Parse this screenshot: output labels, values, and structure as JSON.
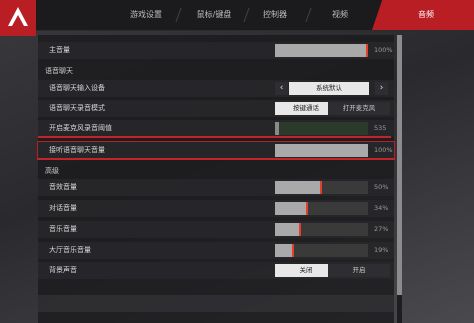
{
  "tabs": [
    {
      "label": "游戏设置",
      "active": false
    },
    {
      "label": "鼠标/键盘",
      "active": false
    },
    {
      "label": "控制器",
      "active": false
    },
    {
      "label": "视频",
      "active": false
    },
    {
      "label": "音频",
      "active": true
    }
  ],
  "master": {
    "label": "主音量",
    "value": "100%",
    "level": 1.0
  },
  "voice_section": "语音聊天",
  "voice": {
    "input_device": {
      "label": "语音聊天输入设备",
      "value": "系统默认"
    },
    "record_mode": {
      "label": "语音聊天录音模式",
      "options": [
        "按键通话",
        "打开麦克风"
      ],
      "selected": 0
    },
    "mic_threshold": {
      "label": "开启麦克风录音阈值",
      "value": "535",
      "level": 0.05
    },
    "receive_volume": {
      "label": "接听语音聊天音量",
      "value": "100%",
      "level": 1.0
    }
  },
  "advanced_section": "高级",
  "advanced": [
    {
      "label": "音效音量",
      "value": "50%",
      "level": 0.5
    },
    {
      "label": "对话音量",
      "value": "34%",
      "level": 0.34
    },
    {
      "label": "音乐音量",
      "value": "27%",
      "level": 0.27
    },
    {
      "label": "大厅音乐音量",
      "value": "19%",
      "level": 0.19
    }
  ],
  "background_audio": {
    "label": "背景声音",
    "options": [
      "关闭",
      "开启"
    ],
    "selected": 0
  },
  "colors": {
    "accent": "#b81e23",
    "knob": "#e2402a"
  }
}
